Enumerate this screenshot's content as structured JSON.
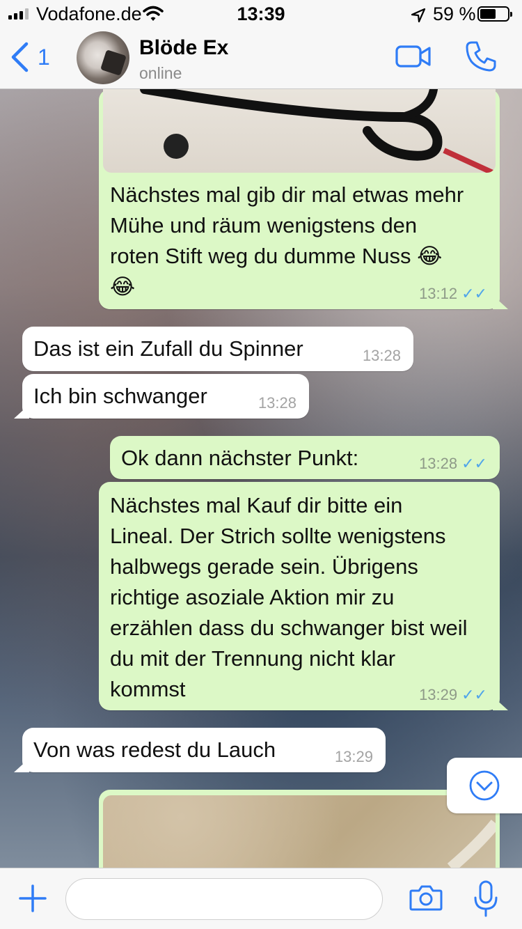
{
  "status_bar": {
    "carrier": "Vodafone.de",
    "time": "13:39",
    "battery_percent": "59 %",
    "battery_level": 0.59
  },
  "header": {
    "back_count": "1",
    "contact_name": "Blöde Ex",
    "contact_status": "online"
  },
  "messages": [
    {
      "direction": "out",
      "text": "Nächstes mal gib dir mal etwas mehr Mühe und räum wenigstens den roten Stift weg du dumme Nuss 😂😂",
      "time": "13:12",
      "status": "read"
    },
    {
      "direction": "in",
      "text": "Das ist ein Zufall du Spinner",
      "time": "13:28"
    },
    {
      "direction": "in",
      "text": "Ich bin schwanger",
      "time": "13:28"
    },
    {
      "direction": "out",
      "text": "Ok dann nächster Punkt:",
      "time": "13:28",
      "status": "read"
    },
    {
      "direction": "out",
      "text": "Nächstes mal Kauf dir bitte ein Lineal. Der Strich sollte wenigstens halbwegs gerade sein. Übrigens richtige asoziale Aktion mir zu erzählen dass du schwanger bist weil du mit der Trennung nicht klar kommst",
      "time": "13:29",
      "status": "read"
    },
    {
      "direction": "in",
      "text": "Von was redest du Lauch",
      "time": "13:29"
    }
  ],
  "input": {
    "placeholder": "",
    "value": ""
  },
  "icons": {
    "back": "chevron-left-icon",
    "video": "video-camera-icon",
    "call": "phone-icon",
    "scroll_down": "chevron-down-circle-icon",
    "plus": "plus-icon",
    "camera": "camera-icon",
    "mic": "microphone-icon"
  },
  "colors": {
    "accent": "#2f7cf6",
    "outgoing_bubble": "#dcf8c6",
    "incoming_bubble": "#ffffff",
    "read_tick": "#4fa4ea"
  }
}
